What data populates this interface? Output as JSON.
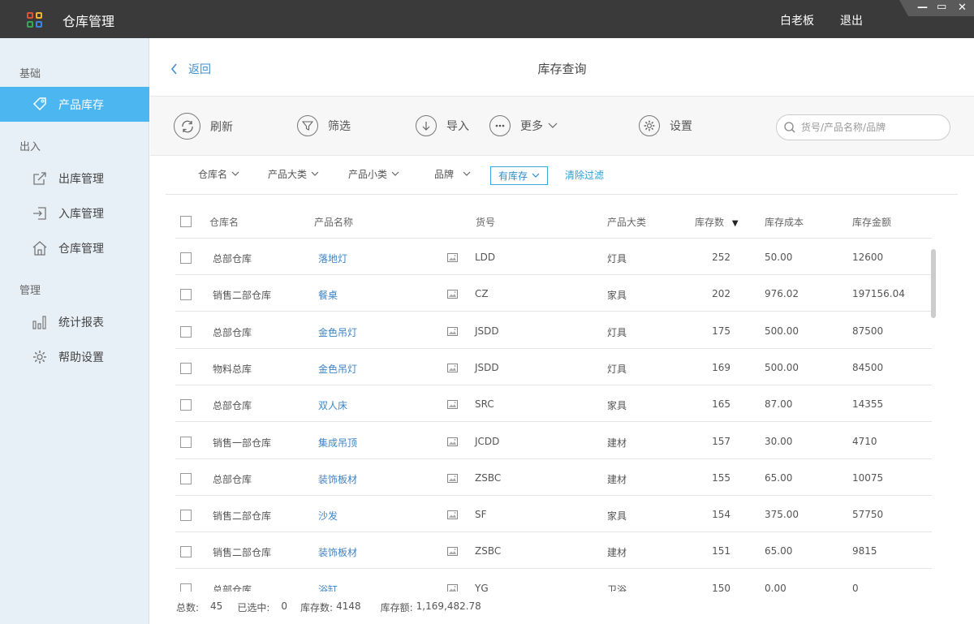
{
  "app": {
    "title": "仓库管理",
    "logo_colors": [
      "#e0533a",
      "#f2b233",
      "#35a853",
      "#3a86e0"
    ],
    "user": "白老板",
    "logout": "退出"
  },
  "sidebar": {
    "sections": [
      {
        "label": "基础"
      },
      {
        "label": "出入"
      },
      {
        "label": "管理"
      }
    ],
    "items": [
      {
        "label": "产品库存",
        "icon": "tag-icon",
        "active": true
      },
      {
        "label": "出库管理",
        "icon": "export-icon"
      },
      {
        "label": "入库管理",
        "icon": "import-icon"
      },
      {
        "label": "仓库管理",
        "icon": "warehouse-icon"
      },
      {
        "label": "统计报表",
        "icon": "bar-chart-icon"
      },
      {
        "label": "帮助设置",
        "icon": "gear-icon"
      }
    ]
  },
  "header": {
    "back_label": "返回",
    "page_title": "库存查询"
  },
  "toolbar": {
    "refresh": "刷新",
    "filter": "筛选",
    "import": "导入",
    "more": "更多",
    "settings": "设置",
    "search_placeholder": "货号/产品名称/品牌"
  },
  "filters": {
    "warehouse": "仓库名",
    "category": "产品大类",
    "subcategory": "产品小类",
    "brand": "品牌",
    "in_stock": "有库存",
    "clear": "清除过滤"
  },
  "table": {
    "columns": {
      "warehouse": "仓库名",
      "product": "产品名称",
      "sku": "货号",
      "category": "产品大类",
      "stock": "库存数",
      "cost": "库存成本",
      "amount": "库存金额"
    },
    "sort_indicator": "▼",
    "rows": [
      {
        "warehouse": "总部仓库",
        "product": "落地灯",
        "sku": "LDD",
        "category": "灯具",
        "stock": "252",
        "cost": "50.00",
        "amount": "12600"
      },
      {
        "warehouse": "销售二部仓库",
        "product": "餐桌",
        "sku": "CZ",
        "category": "家具",
        "stock": "202",
        "cost": "976.02",
        "amount": "197156.04"
      },
      {
        "warehouse": "总部仓库",
        "product": "金色吊灯",
        "sku": "JSDD",
        "category": "灯具",
        "stock": "175",
        "cost": "500.00",
        "amount": "87500"
      },
      {
        "warehouse": "物料总库",
        "product": "金色吊灯",
        "sku": "JSDD",
        "category": "灯具",
        "stock": "169",
        "cost": "500.00",
        "amount": "84500"
      },
      {
        "warehouse": "总部仓库",
        "product": "双人床",
        "sku": "SRC",
        "category": "家具",
        "stock": "165",
        "cost": "87.00",
        "amount": "14355"
      },
      {
        "warehouse": "销售一部仓库",
        "product": "集成吊顶",
        "sku": "JCDD",
        "category": "建材",
        "stock": "157",
        "cost": "30.00",
        "amount": "4710"
      },
      {
        "warehouse": "总部仓库",
        "product": "装饰板材",
        "sku": "ZSBC",
        "category": "建材",
        "stock": "155",
        "cost": "65.00",
        "amount": "10075"
      },
      {
        "warehouse": "销售二部仓库",
        "product": "沙发",
        "sku": "SF",
        "category": "家具",
        "stock": "154",
        "cost": "375.00",
        "amount": "57750"
      },
      {
        "warehouse": "销售二部仓库",
        "product": "装饰板材",
        "sku": "ZSBC",
        "category": "建材",
        "stock": "151",
        "cost": "65.00",
        "amount": "9815"
      },
      {
        "warehouse": "总部仓库",
        "product": "浴缸",
        "sku": "YG",
        "category": "卫浴",
        "stock": "150",
        "cost": "0.00",
        "amount": "0"
      }
    ]
  },
  "footer": {
    "total_label": "总数:",
    "total": "45",
    "selected_label": "已选中:",
    "selected": "0",
    "stock_label": "库存数:",
    "stock": "4148",
    "amount_label": "库存额:",
    "amount": "1,169,482.78"
  }
}
